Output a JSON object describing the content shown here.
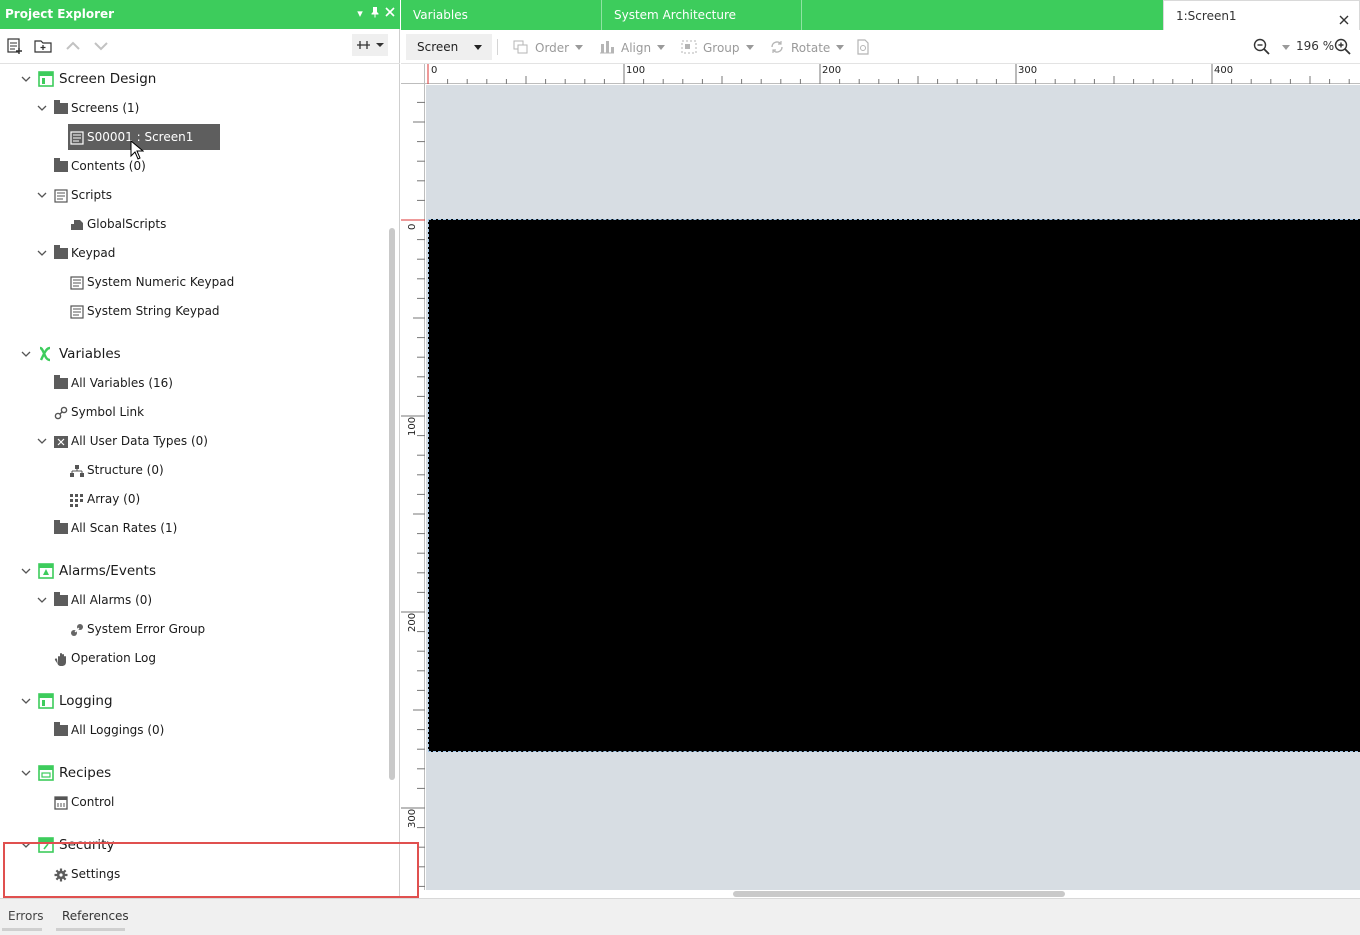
{
  "left_panel": {
    "title": "Project Explorer",
    "header_buttons": [
      "▾",
      "⊣",
      "✕"
    ]
  },
  "tree": {
    "screen_design": "Screen Design",
    "screens": "Screens (1)",
    "screen1": "S00001 : Screen1",
    "contents": "Contents (0)",
    "scripts": "Scripts",
    "global_scripts": "GlobalScripts",
    "keypad": "Keypad",
    "numeric_keypad": "System Numeric Keypad",
    "string_keypad": "System String Keypad",
    "variables": "Variables",
    "all_variables": "All Variables (16)",
    "symbol_link": "Symbol Link",
    "user_data_types": "All User Data Types (0)",
    "structure": "Structure (0)",
    "array": "Array (0)",
    "scan_rates": "All Scan Rates (1)",
    "alarms_events": "Alarms/Events",
    "all_alarms": "All Alarms (0)",
    "system_error_group": "System Error Group",
    "operation_log": "Operation Log",
    "logging": "Logging",
    "all_loggings": "All Loggings (0)",
    "recipes": "Recipes",
    "control": "Control",
    "security": "Security",
    "settings": "Settings"
  },
  "tabs": {
    "variables": "Variables",
    "system_architecture": "System Architecture",
    "screen1": "1:Screen1"
  },
  "editor_toolbar": {
    "screen": "Screen",
    "order": "Order",
    "align": "Align",
    "group": "Group",
    "rotate": "Rotate",
    "zoom": "196 %"
  },
  "ruler": {
    "top": [
      "0",
      "100",
      "200",
      "300",
      "400"
    ],
    "left": [
      "0",
      "100",
      "200",
      "300"
    ]
  },
  "bottom_tabs": {
    "errors": "Errors",
    "references": "References"
  },
  "colors": {
    "accent": "#3dcc5c",
    "highlight": "#e0504f",
    "canvas_bg": "#d7dde3",
    "screen_bg": "#000000"
  }
}
